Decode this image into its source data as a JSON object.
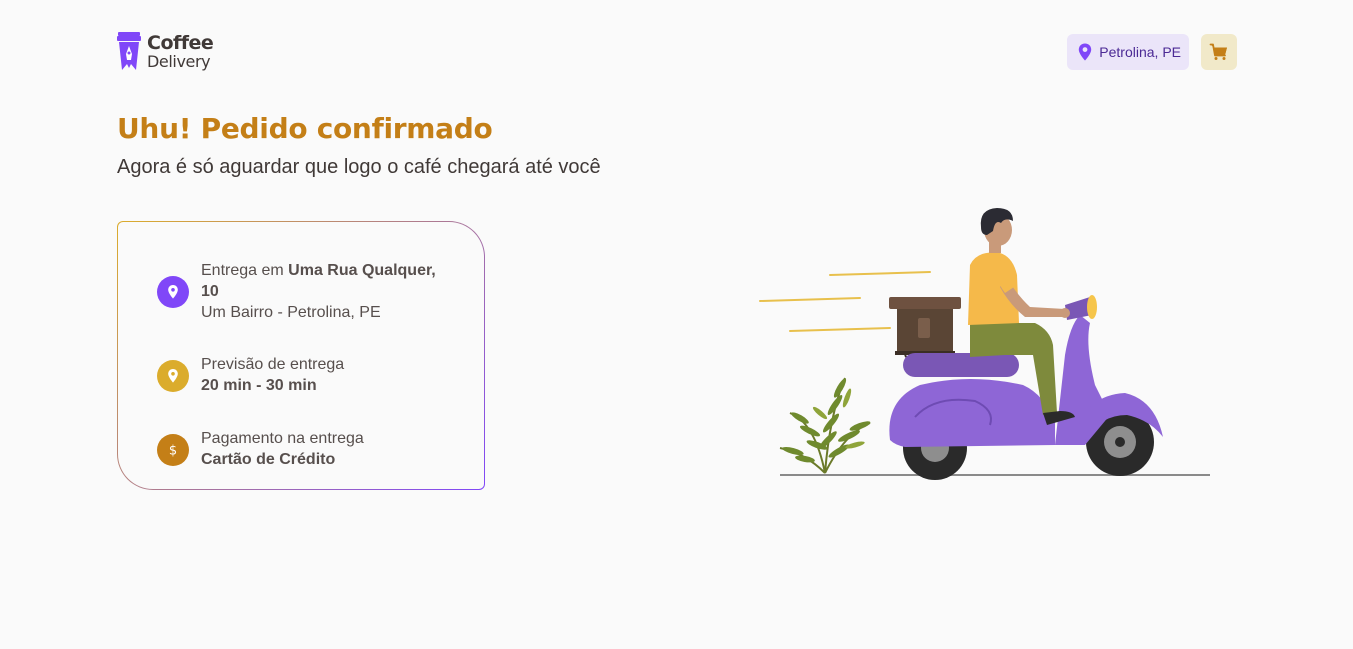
{
  "header": {
    "logo_line1": "Coffee",
    "logo_line2": "Delivery",
    "location": "Petrolina, PE"
  },
  "page": {
    "title": "Uhu! Pedido confirmado",
    "subtitle": "Agora é só aguardar que logo o café chegará até você"
  },
  "info": {
    "delivery": {
      "prefix": "Entrega em ",
      "street": "Uma Rua Qualquer, 10",
      "district": "Um Bairro - Petrolina, PE",
      "icon": "map-pin-icon"
    },
    "eta": {
      "label": "Previsão de entrega",
      "value": "20 min - 30 min",
      "icon": "timer-icon"
    },
    "payment": {
      "label": "Pagamento na entrega",
      "value": "Cartão de Crédito",
      "icon": "currency-dollar-icon"
    }
  },
  "colors": {
    "purple": "#8047F8",
    "purple_dark": "#4B2995",
    "purple_light": "#EBE5F9",
    "yellow": "#DBAC2C",
    "yellow_dark": "#C47F17",
    "yellow_light": "#F1E9C9",
    "background": "#FAFAFA"
  }
}
